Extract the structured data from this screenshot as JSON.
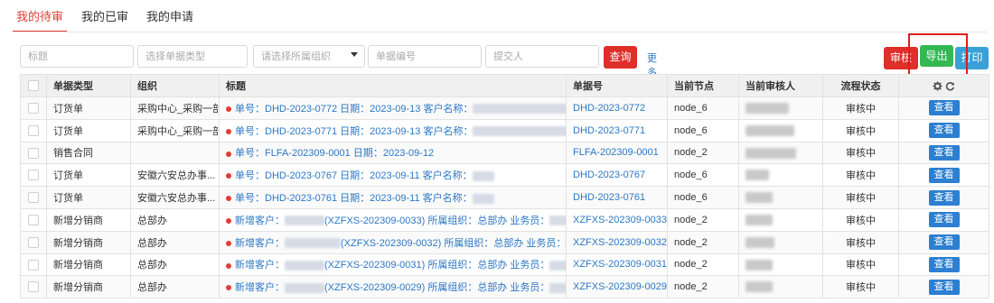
{
  "tabs": [
    {
      "label": "我的待审",
      "active": true
    },
    {
      "label": "我的已审",
      "active": false
    },
    {
      "label": "我的申请",
      "active": false
    }
  ],
  "filters": {
    "title_placeholder": "标题",
    "doctype_placeholder": "选择单据类型",
    "org_placeholder": "请选择所属组织",
    "docno_placeholder": "单据编号",
    "submitter_placeholder": "提交人",
    "search_label": "查询",
    "more_search_label": "更多搜索"
  },
  "actions": {
    "audit_label": "审核",
    "export_label": "导出",
    "print_label": "打印"
  },
  "table": {
    "headers": [
      "单据类型",
      "组织",
      "标题",
      "单据号",
      "当前节点",
      "当前审核人",
      "流程状态"
    ],
    "rows": [
      {
        "type": "订货单",
        "org": "采购中心_采购一部",
        "title_a": "单号：DHD-2023-0772 日期：2023-09-13 客户名称：",
        "title_b": "",
        "docno": "DHD-2023-0772",
        "node": "node_6",
        "status": "审核中",
        "view": "查看"
      },
      {
        "type": "订货单",
        "org": "采购中心_采购一部",
        "title_a": "单号：DHD-2023-0771 日期：2023-09-13 客户名称：",
        "title_b": "",
        "docno": "DHD-2023-0771",
        "node": "node_6",
        "status": "审核中",
        "view": "查看"
      },
      {
        "type": "销售合同",
        "org": "",
        "title_a": "单号：FLFA-202309-0001 日期：2023-09-12",
        "title_b": "",
        "docno": "FLFA-202309-0001",
        "node": "node_2",
        "status": "审核中",
        "view": "查看"
      },
      {
        "type": "订货单",
        "org": "安徽六安总办事...",
        "title_a": "单号：DHD-2023-0767 日期：2023-09-11 客户名称：",
        "title_b": "",
        "docno": "DHD-2023-0767",
        "node": "node_6",
        "status": "审核中",
        "view": "查看"
      },
      {
        "type": "订货单",
        "org": "安徽六安总办事...",
        "title_a": "单号：DHD-2023-0761 日期：2023-09-11 客户名称：",
        "title_b": "",
        "docno": "DHD-2023-0761",
        "node": "node_6",
        "status": "审核中",
        "view": "查看"
      },
      {
        "type": "新增分销商",
        "org": "总部办",
        "title_a": "新增客户：",
        "title_b": "(XZFXS-202309-0033) 所属组织：总部办 业务员：",
        "docno": "XZFXS-202309-0033",
        "node": "node_2",
        "status": "审核中",
        "view": "查看"
      },
      {
        "type": "新增分销商",
        "org": "总部办",
        "title_a": "新增客户：",
        "title_b": "(XZFXS-202309-0032) 所属组织：总部办 业务员：",
        "docno": "XZFXS-202309-0032",
        "node": "node_2",
        "status": "审核中",
        "view": "查看"
      },
      {
        "type": "新增分销商",
        "org": "总部办",
        "title_a": "新增客户：",
        "title_b": "(XZFXS-202309-0031) 所属组织：总部办 业务员：",
        "docno": "XZFXS-202309-0031",
        "node": "node_2",
        "status": "审核中",
        "view": "查看"
      },
      {
        "type": "新增分销商",
        "org": "总部办",
        "title_a": "新增客户：",
        "title_b": "(XZFXS-202309-0029) 所属组织：总部办 业务员：",
        "docno": "XZFXS-202309-0029",
        "node": "node_2",
        "status": "审核中",
        "view": "查看"
      }
    ]
  },
  "colors": {
    "accent": "#e23d35",
    "link": "#2c77c6",
    "export_button": "#34b852",
    "print_button": "#39a0d8",
    "view_button": "#2c7fd1",
    "annotation_box": "#e21b1b"
  }
}
